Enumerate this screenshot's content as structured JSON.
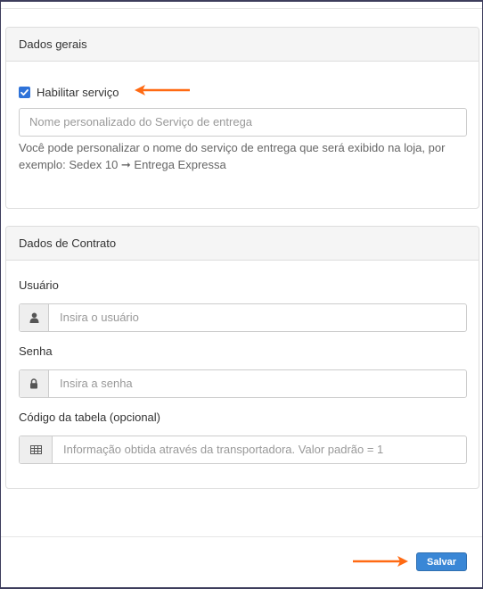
{
  "general_panel": {
    "title": "Dados gerais",
    "enable_service_label": "Habilitar serviço",
    "enable_service_checked": true,
    "custom_name_placeholder": "Nome personalizado do Serviço de entrega",
    "help_text": "Você pode personalizar o nome do serviço de entrega que será exibido na loja, por exemplo: Sedex 10 ➞ Entrega Expressa"
  },
  "contract_panel": {
    "title": "Dados de Contrato",
    "user_label": "Usuário",
    "user_placeholder": "Insira o usuário",
    "password_label": "Senha",
    "password_placeholder": "Insira a senha",
    "table_code_label": "Código da tabela (opcional)",
    "table_code_placeholder": "Informação obtida através da transportadora. Valor padrão = 1"
  },
  "footer": {
    "save_label": "Salvar"
  },
  "colors": {
    "accent": "#3a87d6",
    "checkbox": "#2f73d9",
    "annotation_arrow": "#ff6a13"
  }
}
